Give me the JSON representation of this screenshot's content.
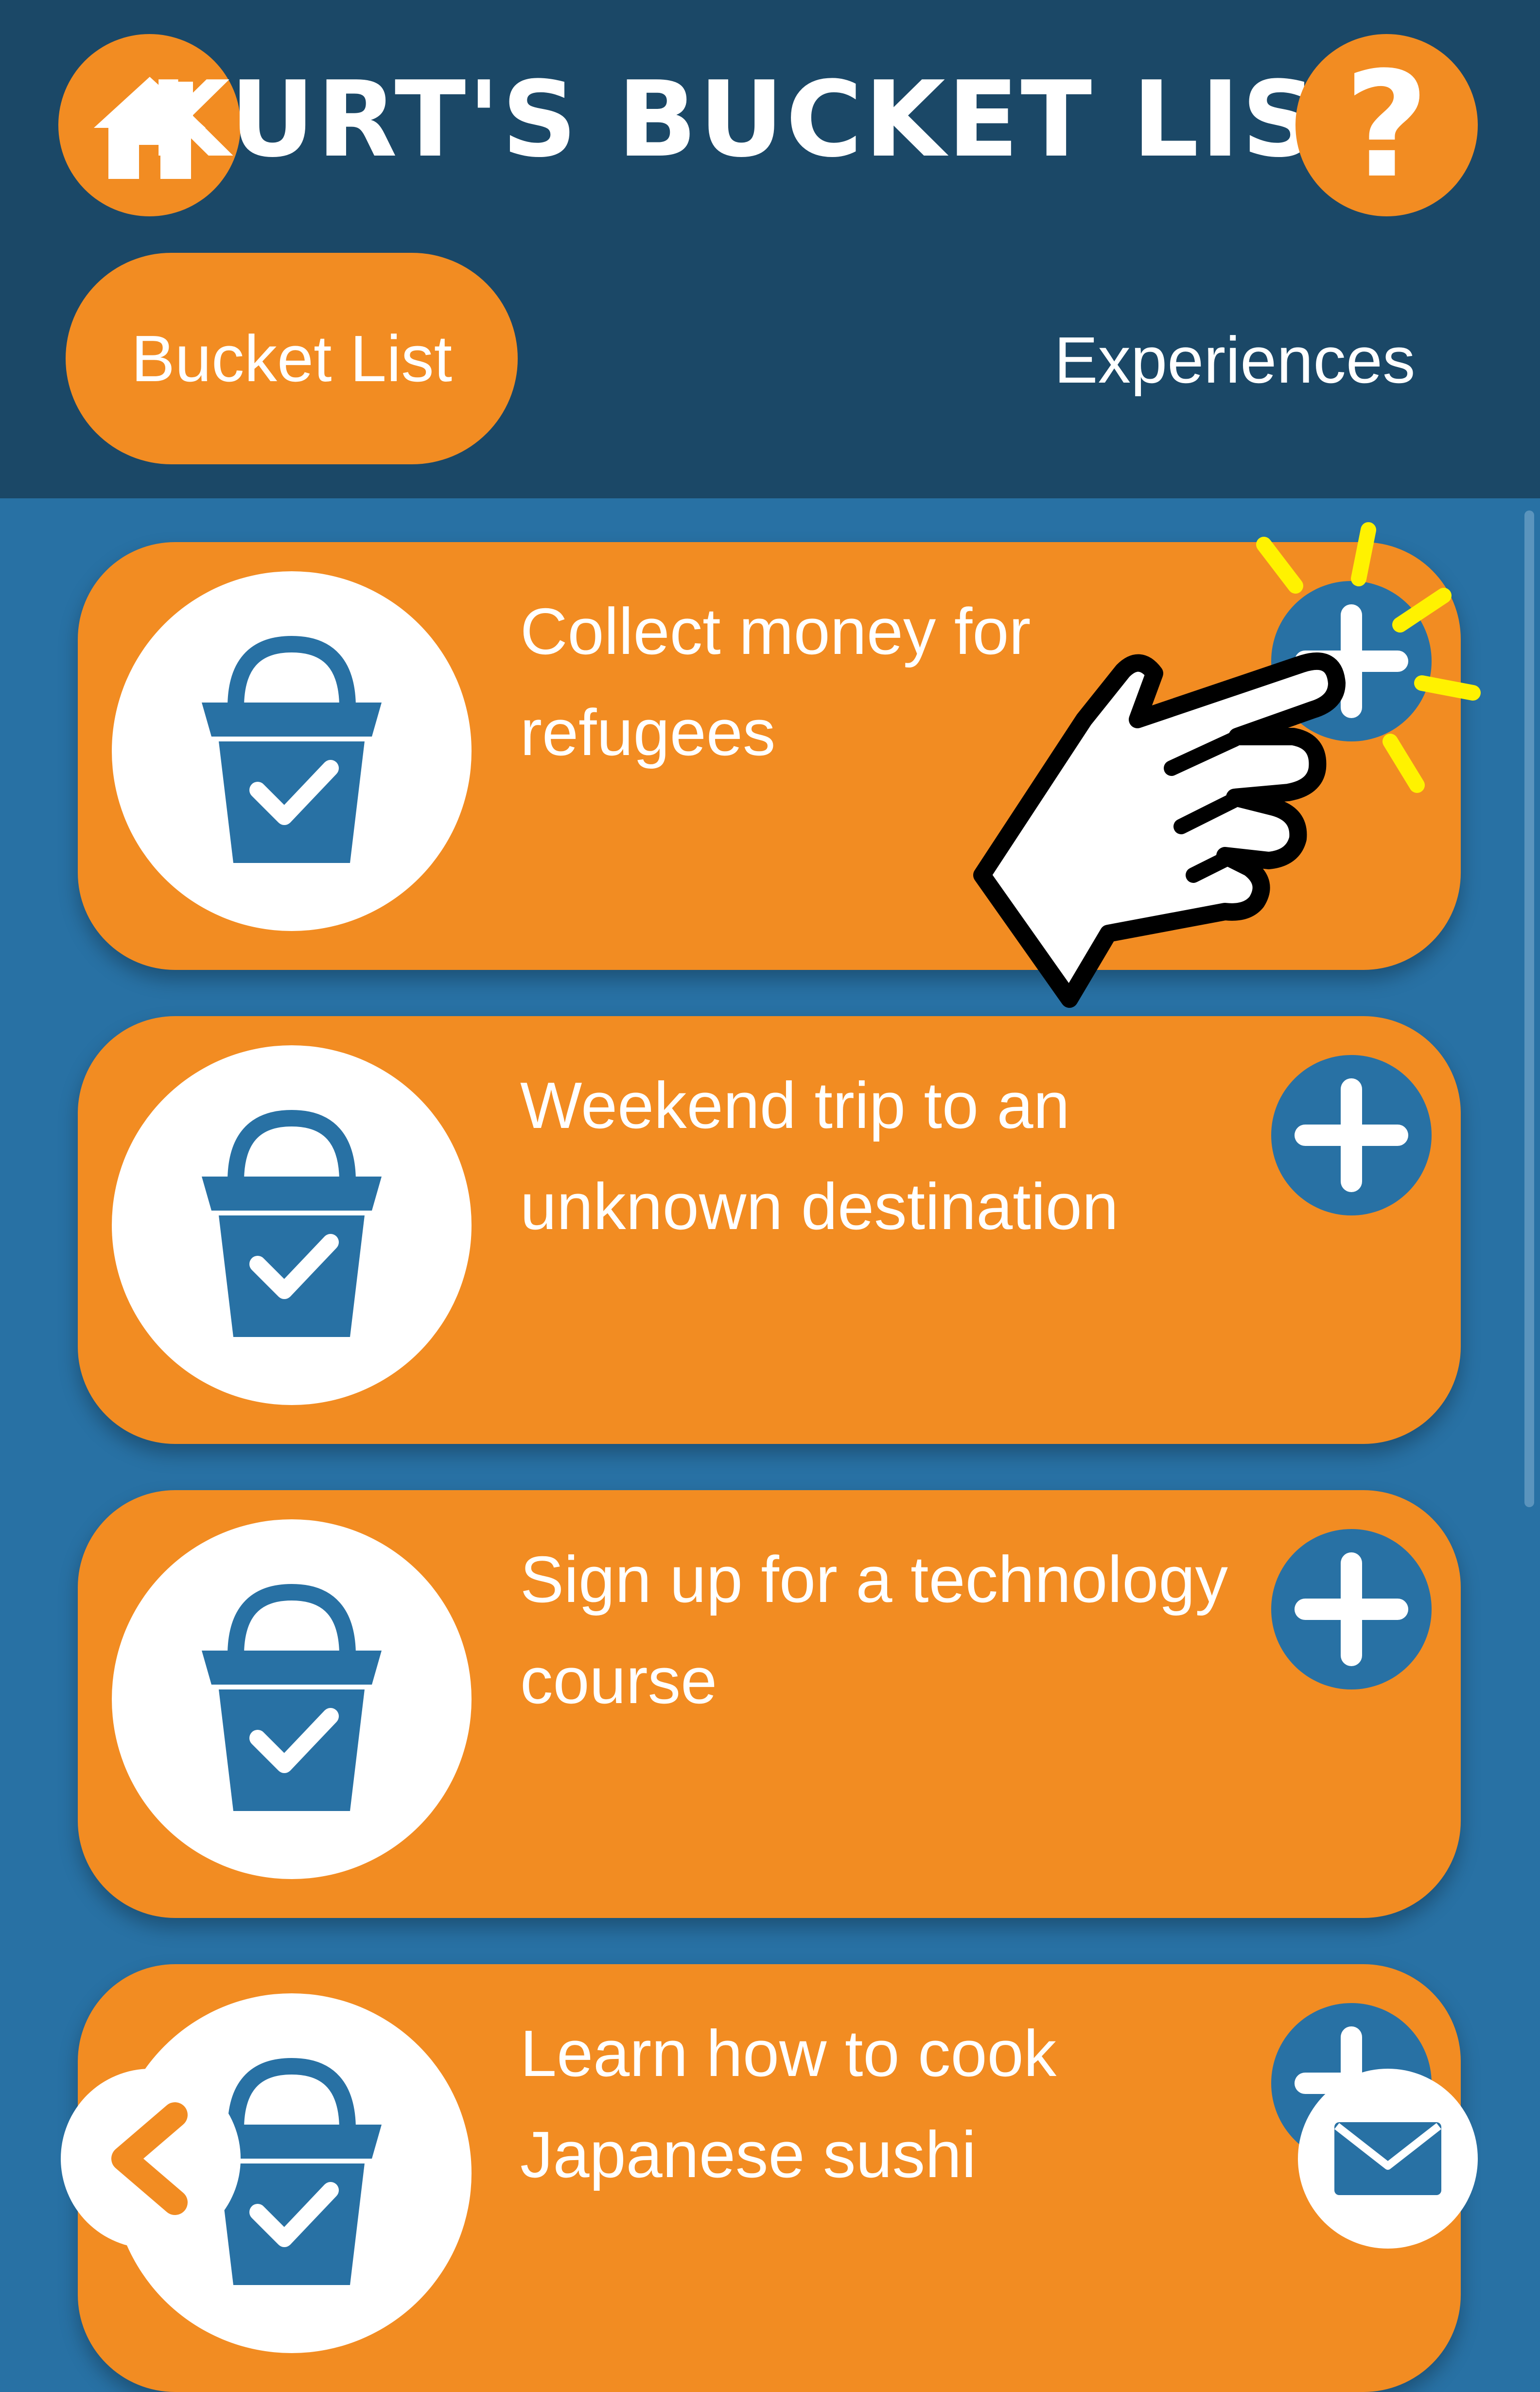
{
  "app": {
    "title": "KURT'S BUCKET LIST",
    "help_symbol": "?"
  },
  "tabs": [
    {
      "label": "Bucket List",
      "active": true
    },
    {
      "label": "Experiences",
      "active": false
    }
  ],
  "bucket_items": [
    {
      "text": "Collect money for refugees"
    },
    {
      "text": "Weekend trip to an unknown destination"
    },
    {
      "text": "Sign up for a technology course"
    },
    {
      "text": "Learn how to cook Japanese sushi"
    }
  ],
  "icons": {
    "home": "home-icon",
    "help": "question-mark-icon",
    "bucket": "bucket-check-icon",
    "add": "plus-icon",
    "back": "chevron-left-icon",
    "mail": "envelope-icon",
    "pointer": "pointing-hand-icon"
  },
  "colors": {
    "header_bg": "#1b4867",
    "page_bg": "#2871a4",
    "accent": "#f28c22",
    "bucket_blue": "#2871a4",
    "tap_highlight": "#fff200"
  }
}
